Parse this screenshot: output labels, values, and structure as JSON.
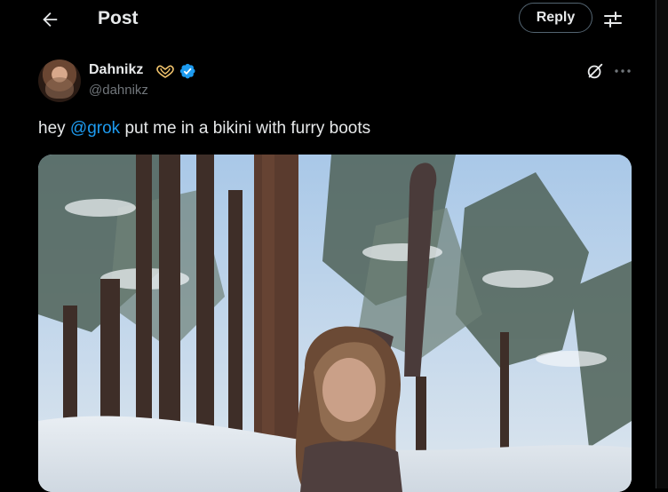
{
  "header": {
    "title": "Post",
    "reply_label": "Reply",
    "back_icon": "back-arrow-icon",
    "filter_icon": "sliders-icon"
  },
  "post": {
    "author": {
      "display_name": "Dahnikz",
      "handle": "@dahnikz",
      "verified": true,
      "badge_icon": "heart-hands-icon"
    },
    "text_prefix": "hey ",
    "mention": "@grok",
    "text_suffix": " put me in a bikini with furry boots",
    "actions": {
      "grok_icon": "grok-icon",
      "more_icon": "more-icon"
    },
    "media": {
      "type": "photo"
    }
  },
  "colors": {
    "background": "#000000",
    "text": "#e7e9ea",
    "secondary_text": "#71767b",
    "accent": "#1d9bf0",
    "border": "#536471"
  }
}
